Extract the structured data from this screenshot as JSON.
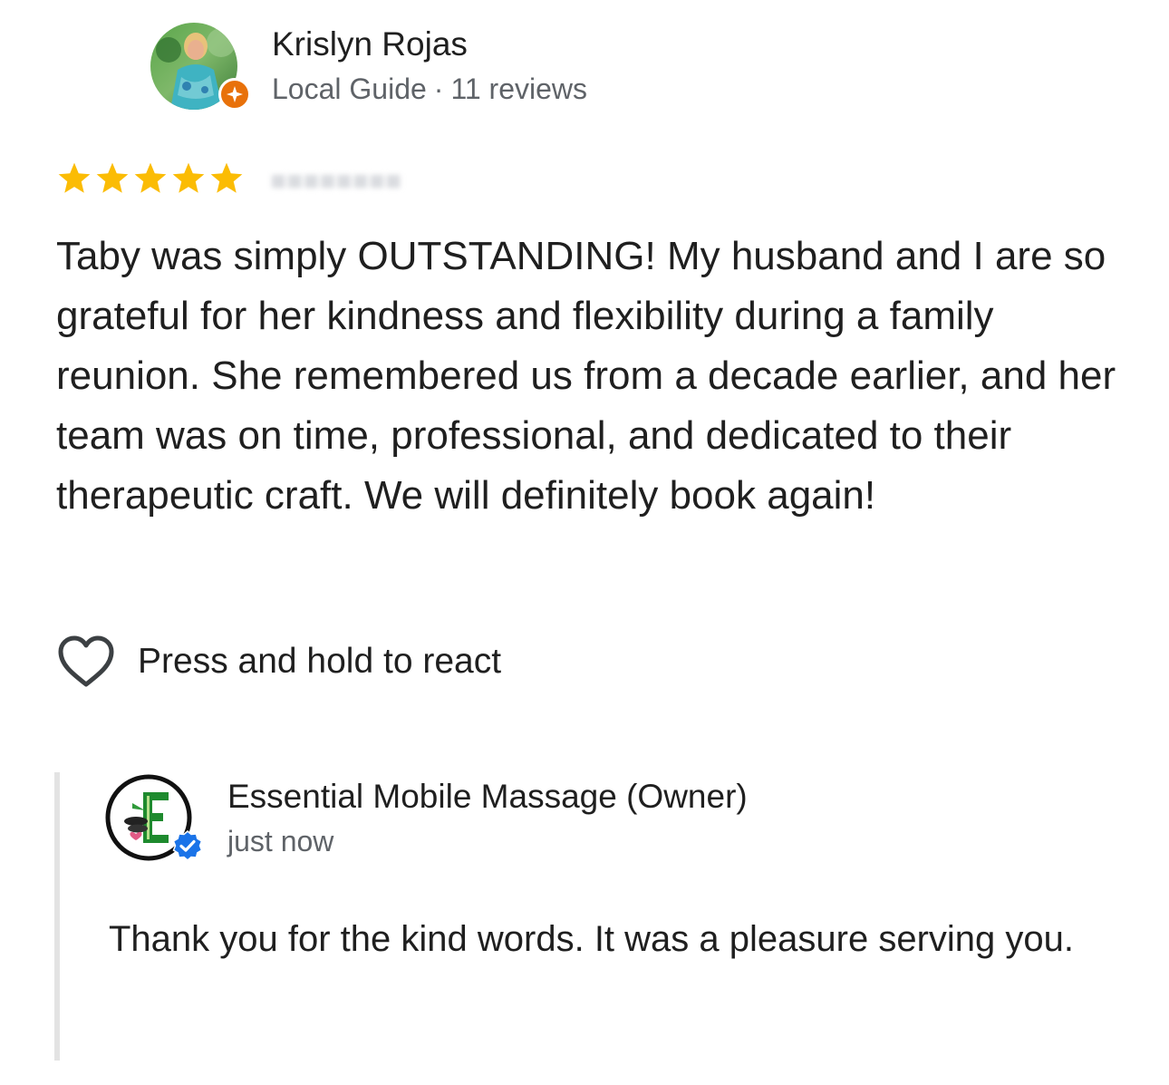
{
  "reviewer": {
    "name": "Krislyn Rojas",
    "level": "Local Guide",
    "separator": "·",
    "review_count": "11 reviews",
    "avatar_icon": "profile-photo",
    "badge_icon": "local-guide-star-icon",
    "badge_color": "#e8710a"
  },
  "rating": {
    "stars": 5,
    "max_stars": 5,
    "star_color": "#fbbc04",
    "star_icon": "star-icon"
  },
  "review": {
    "text": "Taby was simply OUTSTANDING!  My husband and I are so grateful for her kindness and flexibility during a family reunion.  She remembered us from a decade earlier, and her team was on time, professional, and dedicated to their therapeutic craft.  We will definitely book again!"
  },
  "reaction": {
    "icon": "heart-outline-icon",
    "label": "Press and hold to react"
  },
  "owner_reply": {
    "name": "Essential Mobile Massage (Owner)",
    "time": "just now",
    "text": "Thank you for the kind words. It was a pleasure serving you.",
    "logo_icon": "business-logo",
    "verified_icon": "verified-check-icon",
    "verified_color": "#1a73e8"
  }
}
